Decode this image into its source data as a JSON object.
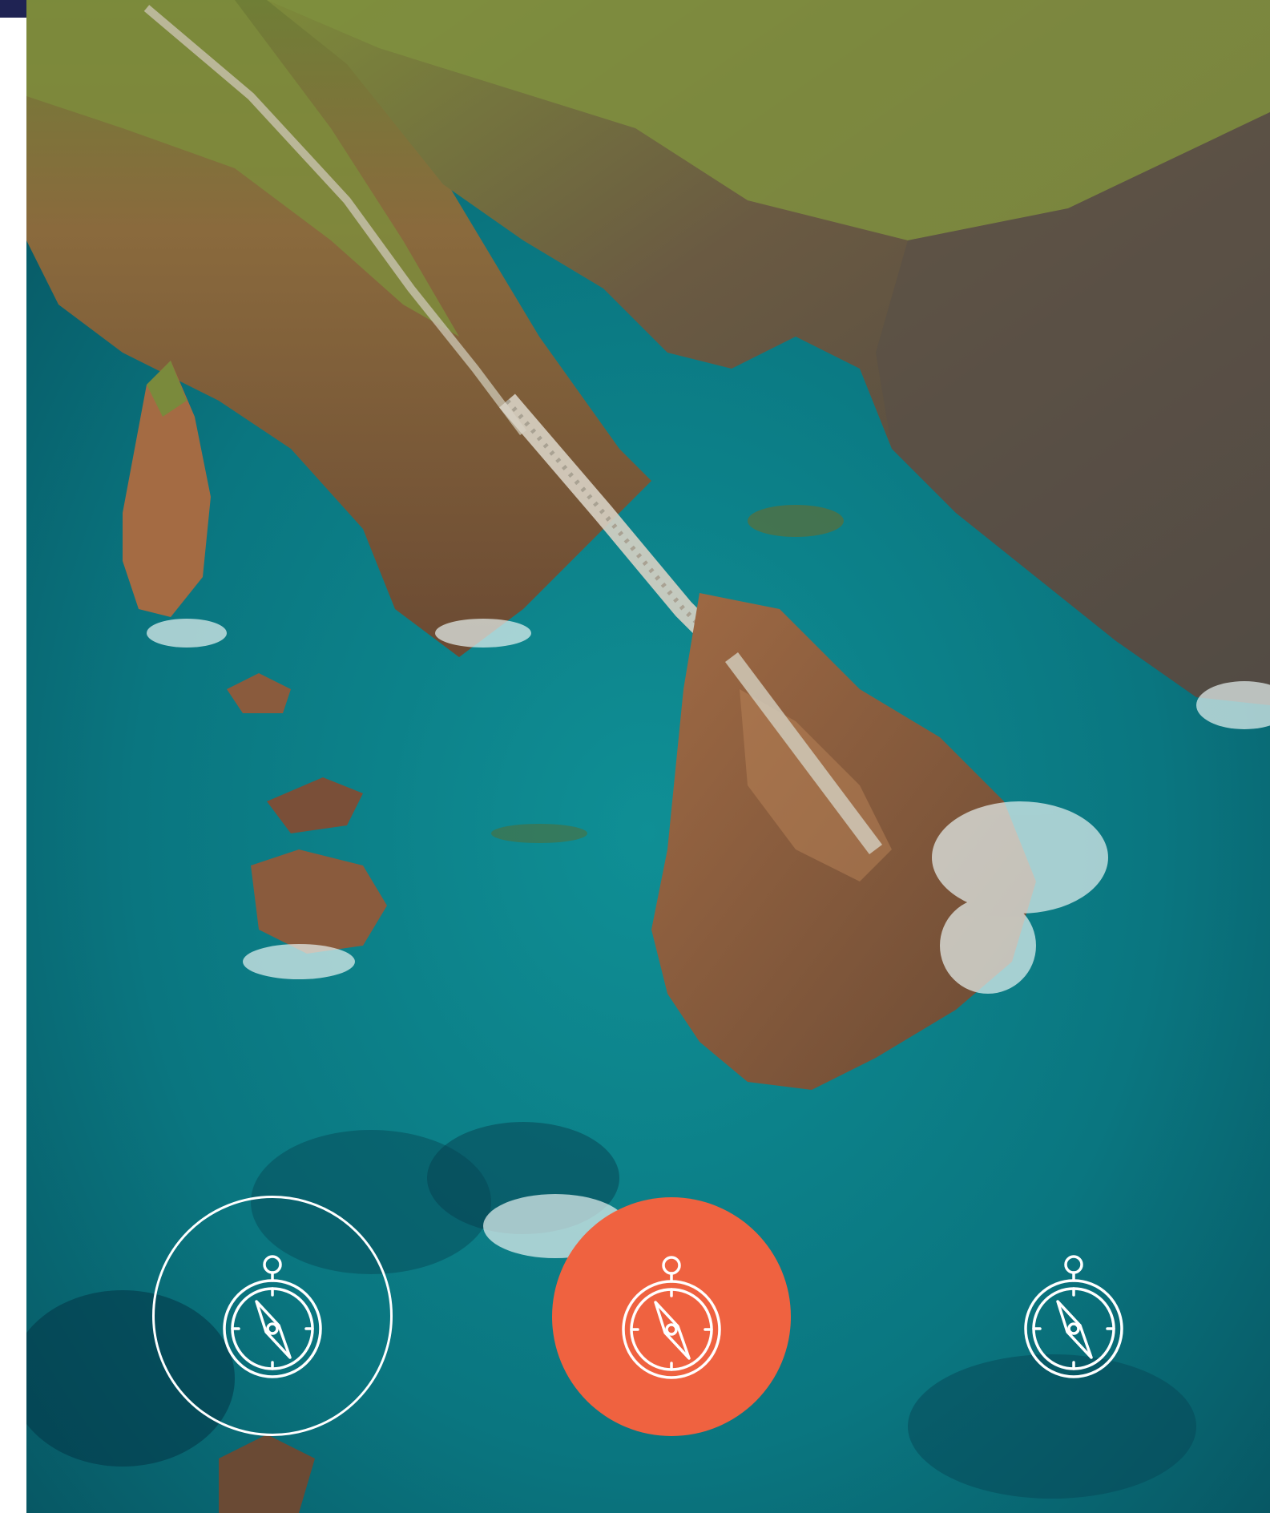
{
  "colors": {
    "top_bar": "#1f2353",
    "accent": "#ef6240",
    "sea": "#0b7b83",
    "rock": "#8a5a3a",
    "grass": "#7a8a3a",
    "icon_stroke": "#ffffff"
  },
  "photo": {
    "subject": "aerial-coastline-footbridge",
    "alt": ""
  },
  "nav_buttons": [
    {
      "icon": "compass-icon",
      "style": "outline",
      "state": "inactive"
    },
    {
      "icon": "compass-icon",
      "style": "filled",
      "state": "active"
    },
    {
      "icon": "compass-icon",
      "style": "plain",
      "state": "inactive"
    }
  ]
}
